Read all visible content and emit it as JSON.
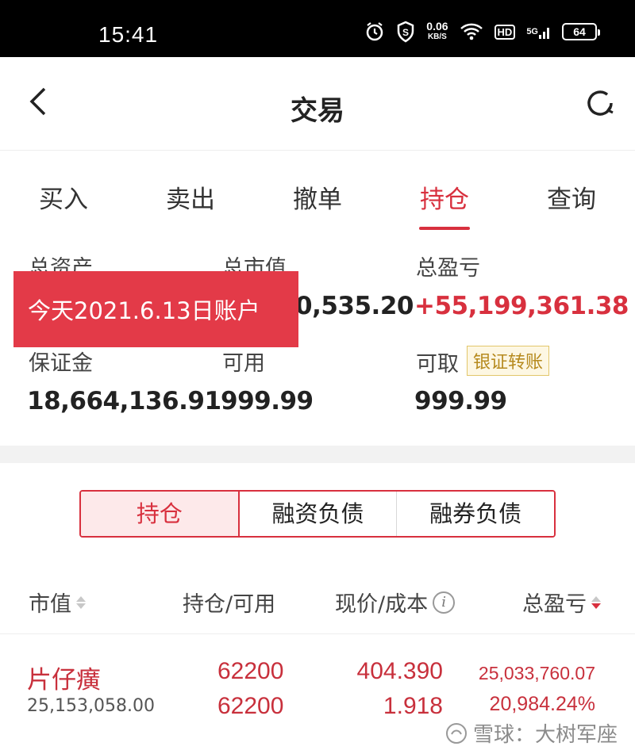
{
  "status_bar": {
    "time": "15:41",
    "speed_value": "0.06",
    "speed_unit": "KB/S",
    "hd_label": "HD",
    "network_label": "5G",
    "battery_level": "64"
  },
  "header": {
    "title": "交易",
    "back_icon": "chevron-left-icon",
    "refresh_icon": "refresh-icon"
  },
  "main_tabs": [
    {
      "label": "买入",
      "active": false
    },
    {
      "label": "卖出",
      "active": false
    },
    {
      "label": "撤单",
      "active": false
    },
    {
      "label": "持仓",
      "active": true
    },
    {
      "label": "查询",
      "active": false
    }
  ],
  "summary": {
    "total_assets_label": "总资产",
    "market_value_label": "总市值",
    "market_value_partial": "0,535.20",
    "total_pnl_label": "总盈亏",
    "total_pnl_value": "+55,199,361.38",
    "margin_label": "保证金",
    "margin_value": "18,664,136.91",
    "available_label": "可用",
    "available_value": "999.99",
    "withdrawable_label": "可取",
    "withdrawable_value": "999.99",
    "transfer_button": "银证转账"
  },
  "overlay_banner": "今天2021.6.13日账户",
  "segmented": [
    {
      "label": "持仓",
      "active": true
    },
    {
      "label": "融资负债",
      "active": false
    },
    {
      "label": "融券负债",
      "active": false
    }
  ],
  "table": {
    "columns": [
      "市值",
      "持仓/可用",
      "现价/成本",
      "总盈亏"
    ],
    "rows": [
      {
        "name": "片仔癀",
        "market_value": "25,153,058.00",
        "position": "62200",
        "available": "62200",
        "current_price": "404.390",
        "cost": "1.918",
        "pnl_amount": "25,033,760.07",
        "pnl_percent": "20,984.24%"
      }
    ]
  },
  "watermark": "雪球：大树军座",
  "colors": {
    "accent_red": "#d8303e",
    "banner_red": "#e33a48",
    "transfer_gold": "#b68a1e"
  }
}
